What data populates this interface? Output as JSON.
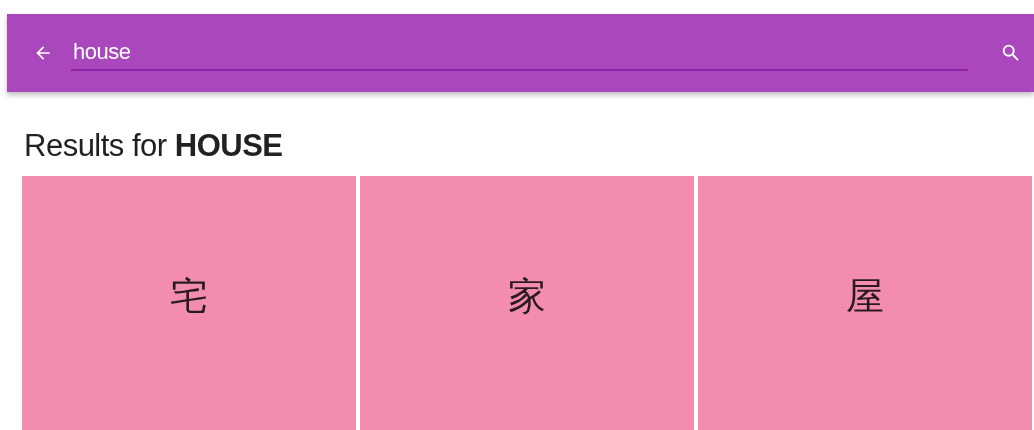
{
  "search_bar": {
    "value": "house"
  },
  "heading": "Results for **HOUSE**",
  "results": [
    {
      "character": "宅"
    },
    {
      "character": "家"
    },
    {
      "character": "屋"
    }
  ]
}
